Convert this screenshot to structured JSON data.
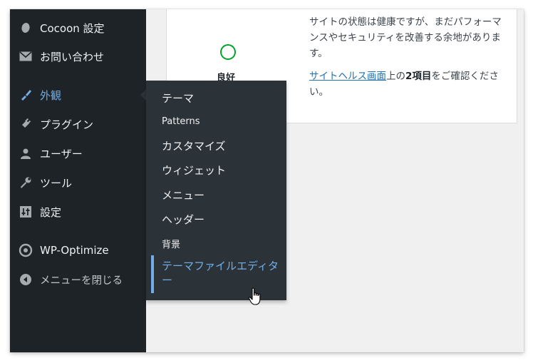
{
  "sidebar": {
    "items": [
      {
        "label": "Cocoon 設定",
        "icon": "cocoon-icon"
      },
      {
        "label": "お問い合わせ",
        "icon": "mail-icon"
      },
      {
        "label": "外観",
        "icon": "brush-icon",
        "current": true
      },
      {
        "label": "プラグイン",
        "icon": "plugin-icon"
      },
      {
        "label": "ユーザー",
        "icon": "user-icon"
      },
      {
        "label": "ツール",
        "icon": "wrench-icon"
      },
      {
        "label": "設定",
        "icon": "settings-icon"
      },
      {
        "label": "WP-Optimize",
        "icon": "wp-optimize-icon"
      },
      {
        "label": "メニューを閉じる",
        "icon": "collapse-icon"
      }
    ]
  },
  "submenu": {
    "items": [
      {
        "label": "テーマ"
      },
      {
        "label": "Patterns"
      },
      {
        "label": "カスタマイズ"
      },
      {
        "label": "ウィジェット"
      },
      {
        "label": "メニュー"
      },
      {
        "label": "ヘッダー"
      },
      {
        "label": "背景"
      },
      {
        "label": "テーマファイルエディター",
        "active": true
      }
    ]
  },
  "site_health": {
    "status": "良好",
    "message": "サイトの状態は健康ですが、まだパフォーマンスやセキュリティを改善する余地があります。",
    "link_text": "サイトヘルス画面",
    "after_link": "上の",
    "count_text": "2項目",
    "after_count": "をご確認ください。"
  },
  "colors": {
    "sidebar_bg": "#1d2327",
    "flyout_bg": "#2c3338",
    "accent": "#72aee6",
    "status_good": "#00a32a",
    "link": "#2271b1"
  }
}
